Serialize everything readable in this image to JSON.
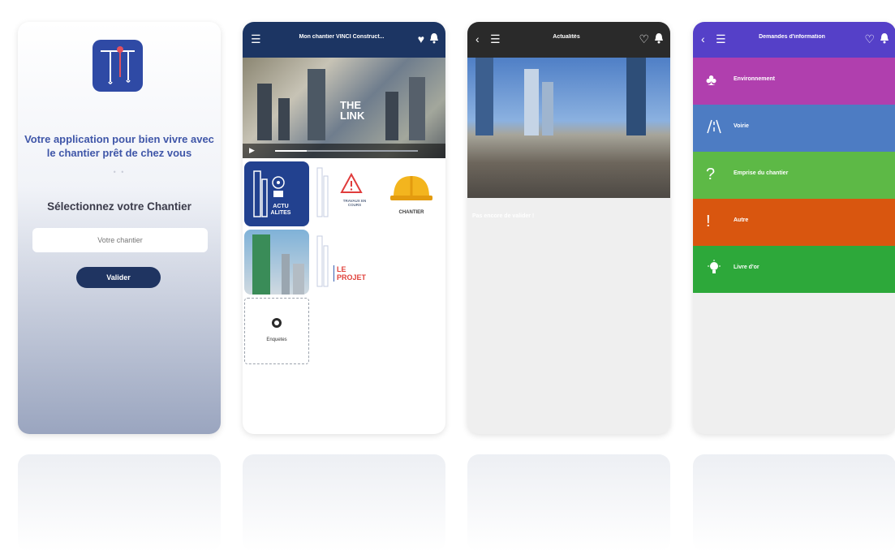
{
  "colors": {
    "brand_blue": "#3f56a8",
    "navy": "#1c3563",
    "validate_button": "#1f3461",
    "header_dark": "#2a2a2a",
    "header_purple": "#5540c8"
  },
  "screen1": {
    "tagline": "Votre application pour bien vivre avec le chantier prêt de chez vous",
    "pager_dots": "• •",
    "select_title": "Sélectionnez votre Chantier",
    "input_placeholder": "Votre chantier",
    "validate_label": "Valider"
  },
  "screen2": {
    "header_title": "Mon chantier VINCI Construct...",
    "video_overlay": "THE LINK",
    "tiles": {
      "actu_label": "ACTU ALITES",
      "travaux_label": "TRAVAUX EN COURS",
      "chantier_label": "CHANTIER",
      "le_projet_label": "LE PROJET"
    },
    "more_label": "Enquetes"
  },
  "screen3": {
    "header_title": "Actualités",
    "news_caption": "Pas encore de valider !"
  },
  "screen4": {
    "header_title": "Demandes d'information",
    "categories": [
      {
        "label": "Environnement",
        "icon": "tree-icon",
        "color": "#b03fae"
      },
      {
        "label": "Voirie",
        "icon": "road-icon",
        "color": "#4d7cc3"
      },
      {
        "label": "Emprise du chantier",
        "icon": "question-icon",
        "color": "#5db946"
      },
      {
        "label": "Autre",
        "icon": "exclamation-icon",
        "color": "#d9560f"
      },
      {
        "label": "Livre d'or",
        "icon": "lightbulb-icon",
        "color": "#2da83a"
      }
    ]
  }
}
